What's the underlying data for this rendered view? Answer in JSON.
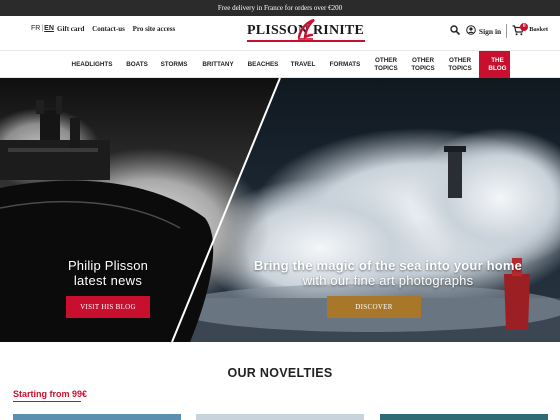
{
  "promo": {
    "text": "Free delivery in France for orders over €200"
  },
  "header": {
    "lang": {
      "fr": "FR",
      "en": "EN",
      "active": "EN"
    },
    "links": [
      "Gift card",
      "Contact-us",
      "Pro site access"
    ],
    "logo": {
      "left": "PLISSON",
      "right": "RINITE"
    },
    "sign_in": "Sign in",
    "basket_label": "Basket",
    "basket_count": "0",
    "icons": {
      "search": "search-icon",
      "user": "user-icon",
      "cart": "cart-icon"
    }
  },
  "nav": {
    "items": [
      {
        "label": "HEADLIGHTS"
      },
      {
        "label": "BOATS"
      },
      {
        "label": "STORMS"
      },
      {
        "label": "BRITTANY"
      },
      {
        "label": "BEACHES"
      },
      {
        "label": "TRAVEL"
      },
      {
        "label": "FORMATS"
      },
      {
        "label": "OTHER TOPICS"
      },
      {
        "label": "OTHER TOPICS"
      },
      {
        "label": "OTHER TOPICS"
      },
      {
        "label": "THE BLOG"
      }
    ]
  },
  "hero": {
    "left": {
      "title": "Philip Plisson",
      "subtitle": "latest news",
      "button": "VISIT HIS BLOG"
    },
    "right": {
      "title": "Bring the magic of the sea into your home",
      "subtitle": "with our fine art photographs",
      "button": "DISCOVER"
    }
  },
  "novelties": {
    "title": "OUR NOVELTIES",
    "starting": "Starting from 99€"
  },
  "colors": {
    "accent": "#c8102e",
    "gold": "#a8772a",
    "dark": "#2b2b2b"
  }
}
